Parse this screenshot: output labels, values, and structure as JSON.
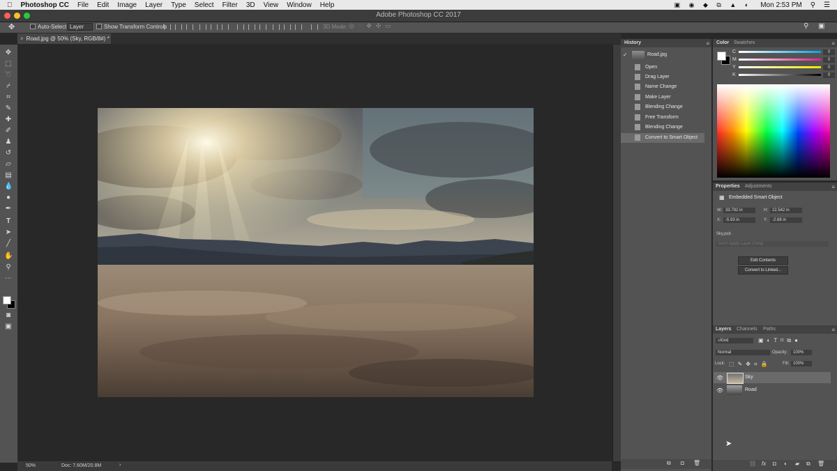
{
  "menubar": {
    "app": "Photoshop CC",
    "items": [
      "File",
      "Edit",
      "Image",
      "Layer",
      "Type",
      "Select",
      "Filter",
      "3D",
      "View",
      "Window",
      "Help"
    ],
    "clock": "Mon 2:53 PM"
  },
  "window": {
    "title": "Adobe Photoshop CC 2017"
  },
  "options": {
    "auto_select_label": "Auto-Select:",
    "auto_select_value": "Layer",
    "transform_controls_label": "Show Transform Controls",
    "mode_3d_label": "3D Mode:"
  },
  "document": {
    "tab_title": "Road.jpg @ 50% (Sky, RGB/8#) *",
    "zoom": "50%",
    "doc_size": "Doc: 7.60M/20.8M"
  },
  "history": {
    "title": "History",
    "snapshot": "Road.jpg",
    "steps": [
      "Open",
      "Drag Layer",
      "Name Change",
      "Make Layer",
      "Blending Change",
      "Free Transform",
      "Blending Change",
      "Convert to Smart Object"
    ],
    "active_step": "Convert to Smart Object"
  },
  "color": {
    "tabs": [
      "Color",
      "Swatches"
    ],
    "channels": [
      {
        "label": "C",
        "value": "0",
        "unit": "%"
      },
      {
        "label": "M",
        "value": "0",
        "unit": "%"
      },
      {
        "label": "Y",
        "value": "0",
        "unit": "%"
      },
      {
        "label": "K",
        "value": "0",
        "unit": "%"
      }
    ]
  },
  "properties": {
    "tabs": [
      "Properties",
      "Adjustments"
    ],
    "type": "Embedded Smart Object",
    "w_label": "W:",
    "w": "33.792 in",
    "h_label": "H:",
    "h": "22.542 in",
    "x_label": "X:",
    "x": "-5.93 in",
    "y_label": "Y:",
    "y": "-2.68 in",
    "source": "Sky.psb",
    "comp_placeholder": "Don't Apply Layer Comp",
    "edit_button": "Edit Contents",
    "convert_button": "Convert to Linked..."
  },
  "layers": {
    "tabs": [
      "Layers",
      "Channels",
      "Paths"
    ],
    "filter": "Kind",
    "blend_mode": "Normal",
    "opacity_label": "Opacity:",
    "opacity": "100%",
    "lock_label": "Lock:",
    "fill_label": "Fill:",
    "fill": "100%",
    "items": [
      {
        "name": "Sky",
        "selected": true
      },
      {
        "name": "Road",
        "selected": false
      }
    ]
  },
  "colors": {
    "accent": "#0f6fc4",
    "panel_bg": "#535353",
    "canvas_bg": "#282828",
    "selected_row": "#6a6a6a"
  }
}
